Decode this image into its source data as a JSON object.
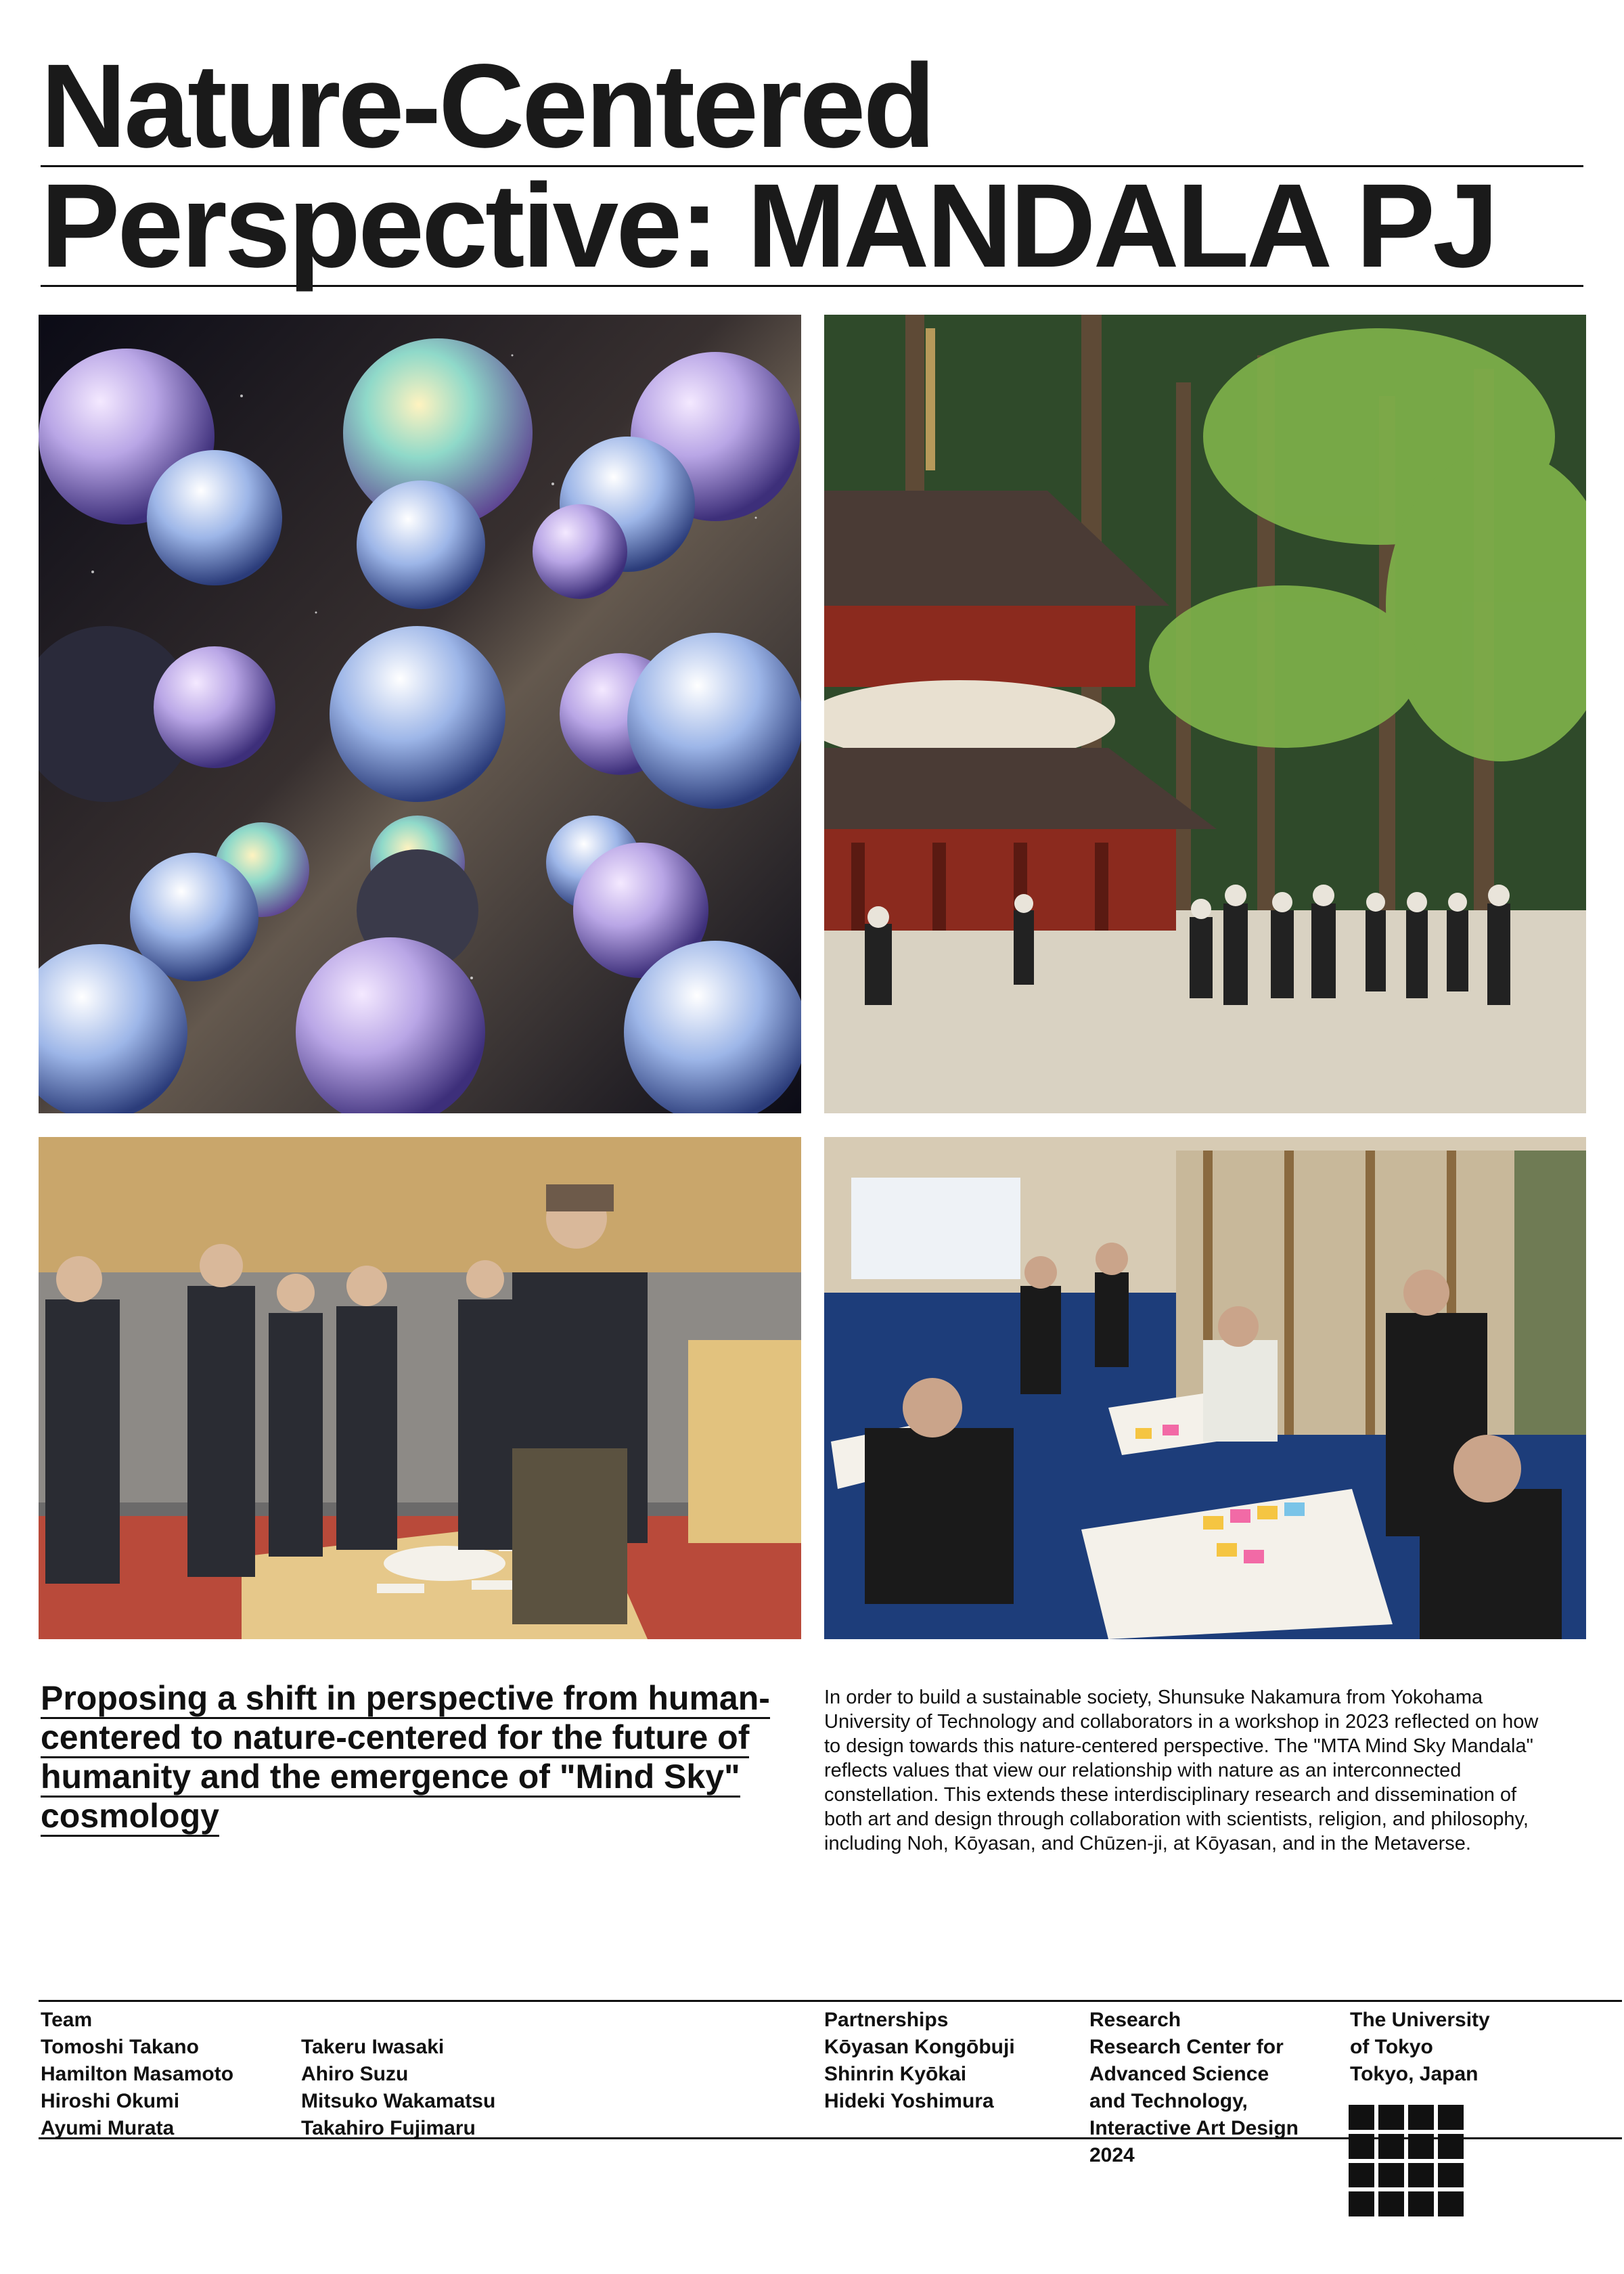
{
  "title": {
    "line1": "Nature-Centered",
    "line2": "Perspective: MANDALA PJ"
  },
  "photos": {
    "spheres": "sky-spheres-artwork",
    "temple": "pagoda-fieldwork",
    "craftsman": "exhibition-talk",
    "workshop": "workshop-session"
  },
  "lead": "Proposing a shift in perspective from human-centered to nature-centered for the future of humanity and the emergence of \"Mind Sky\" cosmology",
  "body": "In order to build a sustainable society, Shunsuke Nakamura from Yokohama University of Technology and collaborators in a workshop in 2023 reflected on how to design towards this nature-centered perspective. The \"MTA Mind Sky Mandala\" reflects values that view our relationship with nature as an interconnected constellation. This extends these interdisciplinary research and dissemination of both art and design through collaboration with scientists, religion, and philosophy, including Noh, Kōyasan, and Chūzen-ji, at Kōyasan, and in the Metaverse.",
  "credits": {
    "team_heading": "Team",
    "team_col1": [
      "Tomoshi Takano",
      "Hamilton Masamoto",
      "Hiroshi Okumi",
      "Ayumi Murata"
    ],
    "team_col2": [
      "Takeru Iwasaki",
      "Ahiro Suzu",
      "Mitsuko Wakamatsu",
      "Takahiro Fujimaru"
    ],
    "partner_heading": "Partnerships",
    "partners": [
      "Kōyasan Kongōbuji",
      "Shinrin Kyōkai",
      "Hideki Yoshimura"
    ],
    "org_heading": "Research",
    "org": [
      "Research Center for",
      "Advanced Science",
      "and Technology,",
      "Interactive Art Design",
      "2024"
    ],
    "univ": [
      "The University",
      "of Tokyo",
      "Tokyo, Japan"
    ]
  },
  "colors": {
    "space": "#0b0b16",
    "forest": "#2f5a2a",
    "pagoda": "#8b2a1e",
    "carpet": "#1d3d7a",
    "hall": "#c9a66b"
  }
}
